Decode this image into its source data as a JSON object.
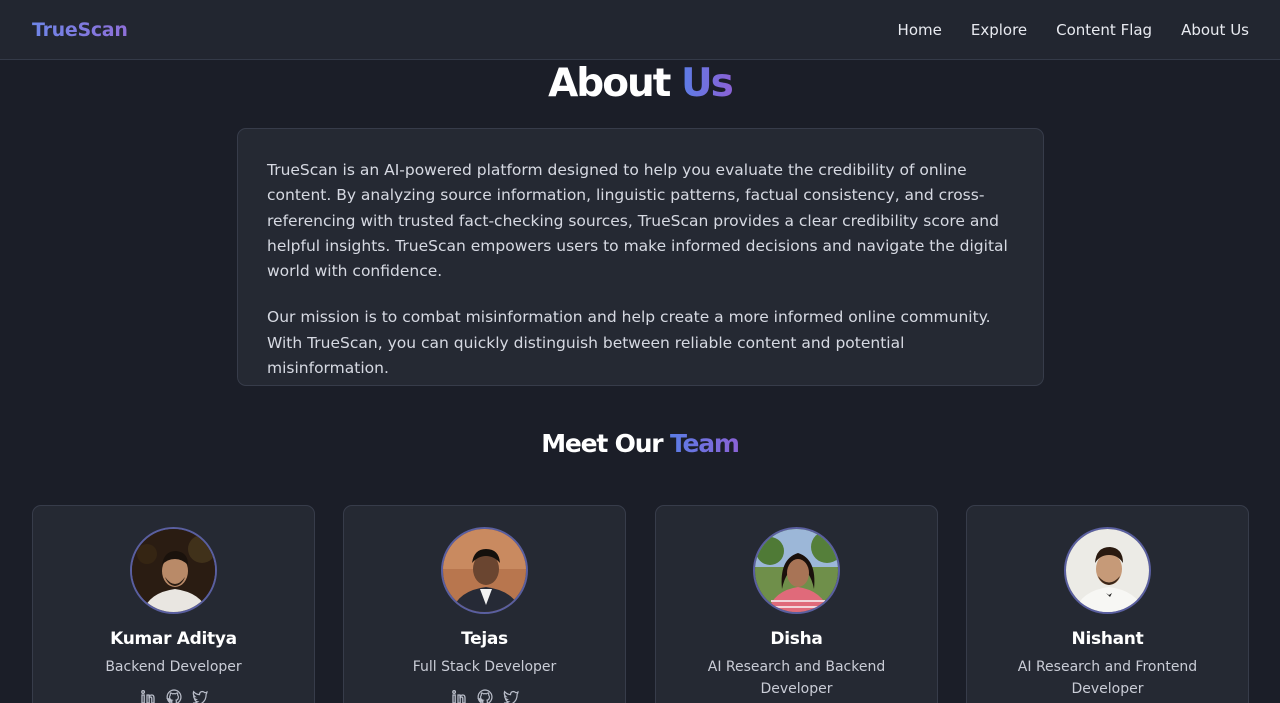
{
  "nav": {
    "brand": "TrueScan",
    "links": [
      "Home",
      "Explore",
      "Content Flag",
      "About Us"
    ]
  },
  "about": {
    "title_part1": "About",
    "title_part2": "Us",
    "paragraphs": [
      "TrueScan is an AI-powered platform designed to help you evaluate the credibility of online content. By analyzing source information, linguistic patterns, factual consistency, and cross-referencing with trusted fact-checking sources, TrueScan provides a clear credibility score and helpful insights. TrueScan empowers users to make informed decisions and navigate the digital world with confidence.",
      "Our mission is to combat misinformation and help create a more informed online community. With TrueScan, you can quickly distinguish between reliable content and potential misinformation."
    ]
  },
  "team": {
    "title_part1": "Meet Our",
    "title_part2": "Team",
    "members": [
      {
        "name": "Kumar Aditya",
        "role": "Backend Developer",
        "socials": [
          "linkedin-icon",
          "github-icon",
          "twitter-icon"
        ]
      },
      {
        "name": "Tejas",
        "role": "Full Stack Developer",
        "socials": [
          "linkedin-icon",
          "github-icon",
          "twitter-icon"
        ]
      },
      {
        "name": "Disha",
        "role": "AI Research and Backend Developer"
      },
      {
        "name": "Nishant",
        "role": "AI Research and Frontend Developer"
      }
    ]
  },
  "colors": {
    "background": "#1b1e28",
    "card": "#252933",
    "accent_start": "#5b7de6",
    "accent_end": "#8a62d6"
  }
}
